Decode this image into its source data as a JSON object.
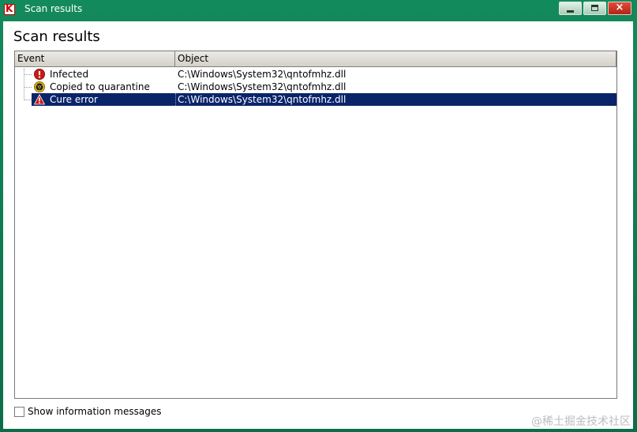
{
  "window": {
    "title": "Scan results",
    "controls": {
      "minimize": "minimize",
      "maximize": "maximize",
      "close": "×"
    }
  },
  "page": {
    "title": "Scan results"
  },
  "table": {
    "columns": [
      "Event",
      "Object"
    ],
    "rows": [
      {
        "event": "Infected",
        "object": "C:\\Windows\\System32\\qntofmhz.dll",
        "icon": "infected-icon",
        "selected": false
      },
      {
        "event": "Copied to quarantine",
        "object": "C:\\Windows\\System32\\qntofmhz.dll",
        "icon": "quarantine-icon",
        "selected": false
      },
      {
        "event": "Cure error",
        "object": "C:\\Windows\\System32\\qntofmhz.dll",
        "icon": "warning-icon",
        "selected": true
      }
    ]
  },
  "footer": {
    "show_info_label": "Show information messages",
    "show_info_checked": false
  },
  "watermark": "@稀土掘金技术社区",
  "colors": {
    "titlebar": "#0e7a52",
    "selection": "#0a246a",
    "infected": "#cc1a1a",
    "quarantine": "#f0c020",
    "warning": "#cc1a1a"
  }
}
